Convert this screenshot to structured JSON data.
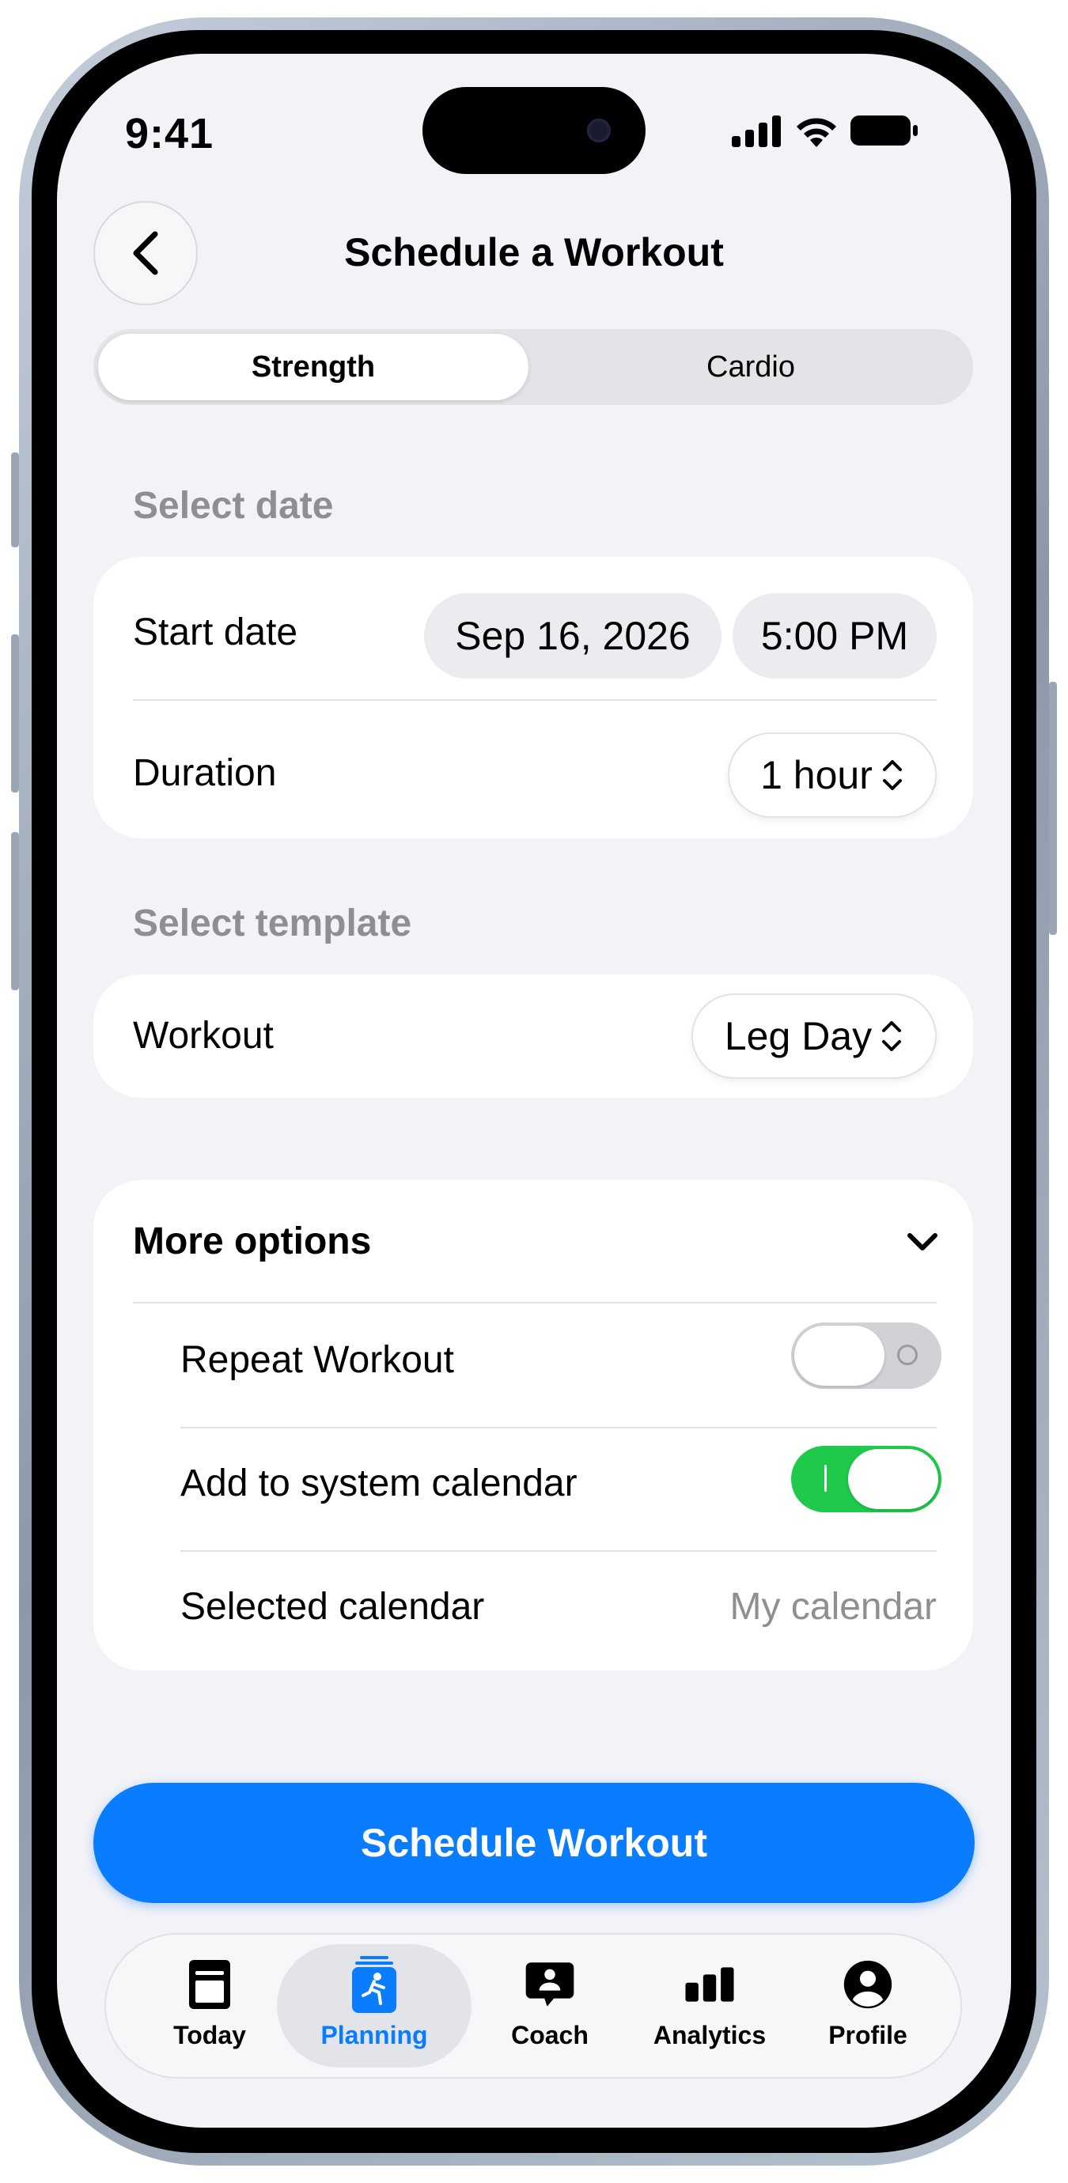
{
  "status_bar": {
    "time": "9:41"
  },
  "header": {
    "title": "Schedule a Workout"
  },
  "segmented": {
    "items": [
      {
        "label": "Strength",
        "selected": true
      },
      {
        "label": "Cardio",
        "selected": false
      }
    ]
  },
  "select_date": {
    "section_label": "Select date",
    "start_date_label": "Start date",
    "start_date_value": "Sep 16, 2026",
    "start_time_value": "5:00 PM",
    "duration_label": "Duration",
    "duration_value": "1 hour"
  },
  "select_template": {
    "section_label": "Select template",
    "workout_label": "Workout",
    "workout_value": "Leg Day"
  },
  "more_options": {
    "title": "More options",
    "repeat_label": "Repeat Workout",
    "repeat_on": false,
    "calendar_label": "Add to system calendar",
    "calendar_on": true,
    "selected_calendar_label": "Selected calendar",
    "selected_calendar_value": "My calendar"
  },
  "cta": {
    "label": "Schedule Workout"
  },
  "tabbar": {
    "items": [
      {
        "label": "Today",
        "icon": "today-icon"
      },
      {
        "label": "Planning",
        "icon": "planning-icon",
        "active": true
      },
      {
        "label": "Coach",
        "icon": "coach-icon"
      },
      {
        "label": "Analytics",
        "icon": "analytics-icon"
      },
      {
        "label": "Profile",
        "icon": "profile-icon"
      }
    ]
  },
  "colors": {
    "accent": "#0a7cff",
    "toggle_on": "#1fc94a",
    "background": "#f2f2f7"
  }
}
